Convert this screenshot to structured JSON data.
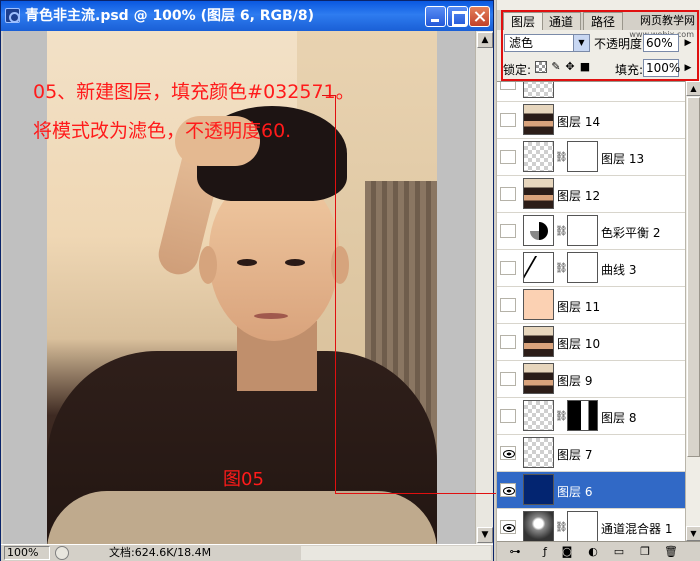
{
  "document": {
    "title": "青色非主流.psd @ 100% (图层 6, RGB/8)",
    "zoom": "100%",
    "status": "文档:624.6K/18.4M"
  },
  "annotation": {
    "line1": "05、新建图层，填充颜色#032571。",
    "line2": "将模式改为滤色，不透明度60.",
    "figure_label": "图05",
    "color": "#ff1a1a"
  },
  "panel": {
    "tabs": [
      "图层",
      "通道",
      "路径"
    ],
    "watermark": "网页教学网",
    "watermark_small": "www.webjx.com",
    "blend_mode": "滤色",
    "opacity_label": "不透明度:",
    "opacity_value": "60%",
    "lock_label": "锁定:",
    "fill_label": "填充:",
    "fill_value": "100%"
  },
  "layers": [
    {
      "name": "",
      "thumb": "checker",
      "visible": false,
      "partial": true
    },
    {
      "name": "图层 14",
      "thumb": "photo",
      "visible": false
    },
    {
      "name": "图层 13",
      "thumb": "checker",
      "visible": false,
      "mask": "white"
    },
    {
      "name": "图层 12",
      "thumb": "photo",
      "visible": false
    },
    {
      "name": "色彩平衡 2",
      "thumb": "adj",
      "visible": false,
      "mask": "white"
    },
    {
      "name": "曲线 3",
      "thumb": "curve",
      "visible": false,
      "mask": "white"
    },
    {
      "name": "图层 11",
      "thumb": "peach",
      "visible": false
    },
    {
      "name": "图层 10",
      "thumb": "photo",
      "visible": false
    },
    {
      "name": "图层 9",
      "thumb": "photo",
      "visible": false
    },
    {
      "name": "图层 8",
      "thumb": "checker",
      "visible": false,
      "mask": "bw"
    },
    {
      "name": "图层 7",
      "thumb": "checker",
      "visible": true
    },
    {
      "name": "图层 6",
      "thumb": "navy",
      "visible": true,
      "selected": true
    },
    {
      "name": "通道混合器 1",
      "thumb": "mono",
      "visible": true,
      "mask": "white"
    }
  ],
  "colors": {
    "fill_color": "#032571",
    "selection": "#3169c6",
    "title_bar": "#0a58e0"
  }
}
